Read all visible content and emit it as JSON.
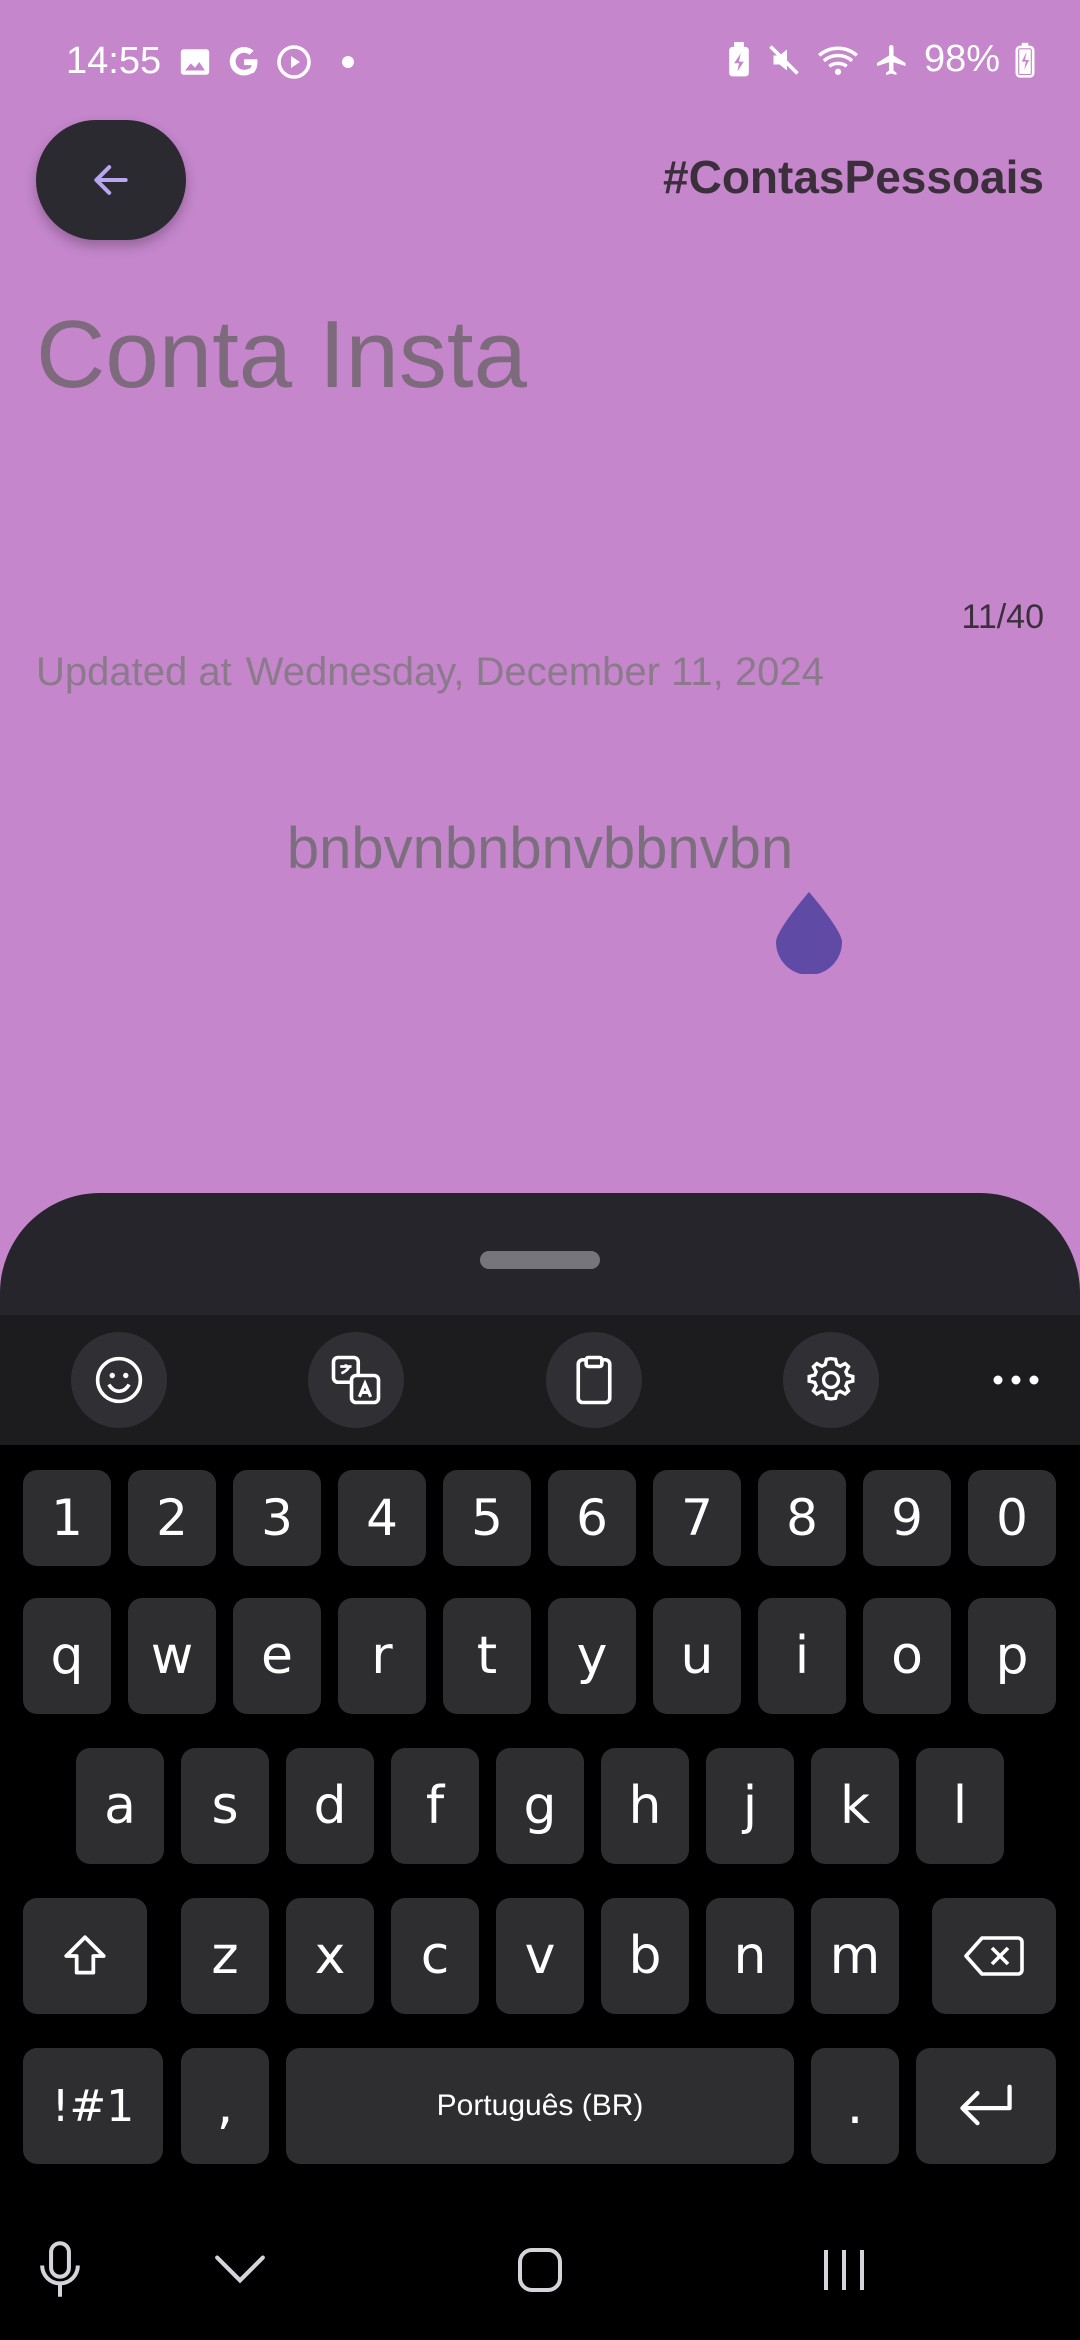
{
  "status_bar": {
    "time": "14:55",
    "battery": "98%",
    "left_icons": [
      "image-icon",
      "google-g-icon",
      "play-circle-icon",
      "dot-icon"
    ],
    "right_icons": [
      "battery-saver-icon",
      "mute-icon",
      "wifi-icon",
      "airplane-icon",
      "battery-charging-icon"
    ]
  },
  "header": {
    "back_icon": "arrow-left-icon",
    "tag": "#ContasPessoais"
  },
  "note": {
    "title": "Conta Insta",
    "char_count": "11/40",
    "updated_label": "Updated at",
    "updated_date": "Wednesday, December 11, 2024",
    "body": "bnbvnbnbnvbbnvbn"
  },
  "keyboard": {
    "toolbar": [
      "emoji-icon",
      "translate-icon",
      "clipboard-icon",
      "settings-icon",
      "more-icon"
    ],
    "number_row": [
      "1",
      "2",
      "3",
      "4",
      "5",
      "6",
      "7",
      "8",
      "9",
      "0"
    ],
    "row1": [
      "q",
      "w",
      "e",
      "r",
      "t",
      "y",
      "u",
      "i",
      "o",
      "p"
    ],
    "row2": [
      "a",
      "s",
      "d",
      "f",
      "g",
      "h",
      "j",
      "k",
      "l"
    ],
    "row3": [
      "z",
      "x",
      "c",
      "v",
      "b",
      "n",
      "m"
    ],
    "symbols_key": "!#1",
    "comma_key": ",",
    "space_label": "Português (BR)",
    "period_key": ".",
    "accent_color": "#5f4ba6"
  },
  "nav": [
    "microphone-icon",
    "chevron-down-icon",
    "home-icon",
    "recents-icon"
  ]
}
